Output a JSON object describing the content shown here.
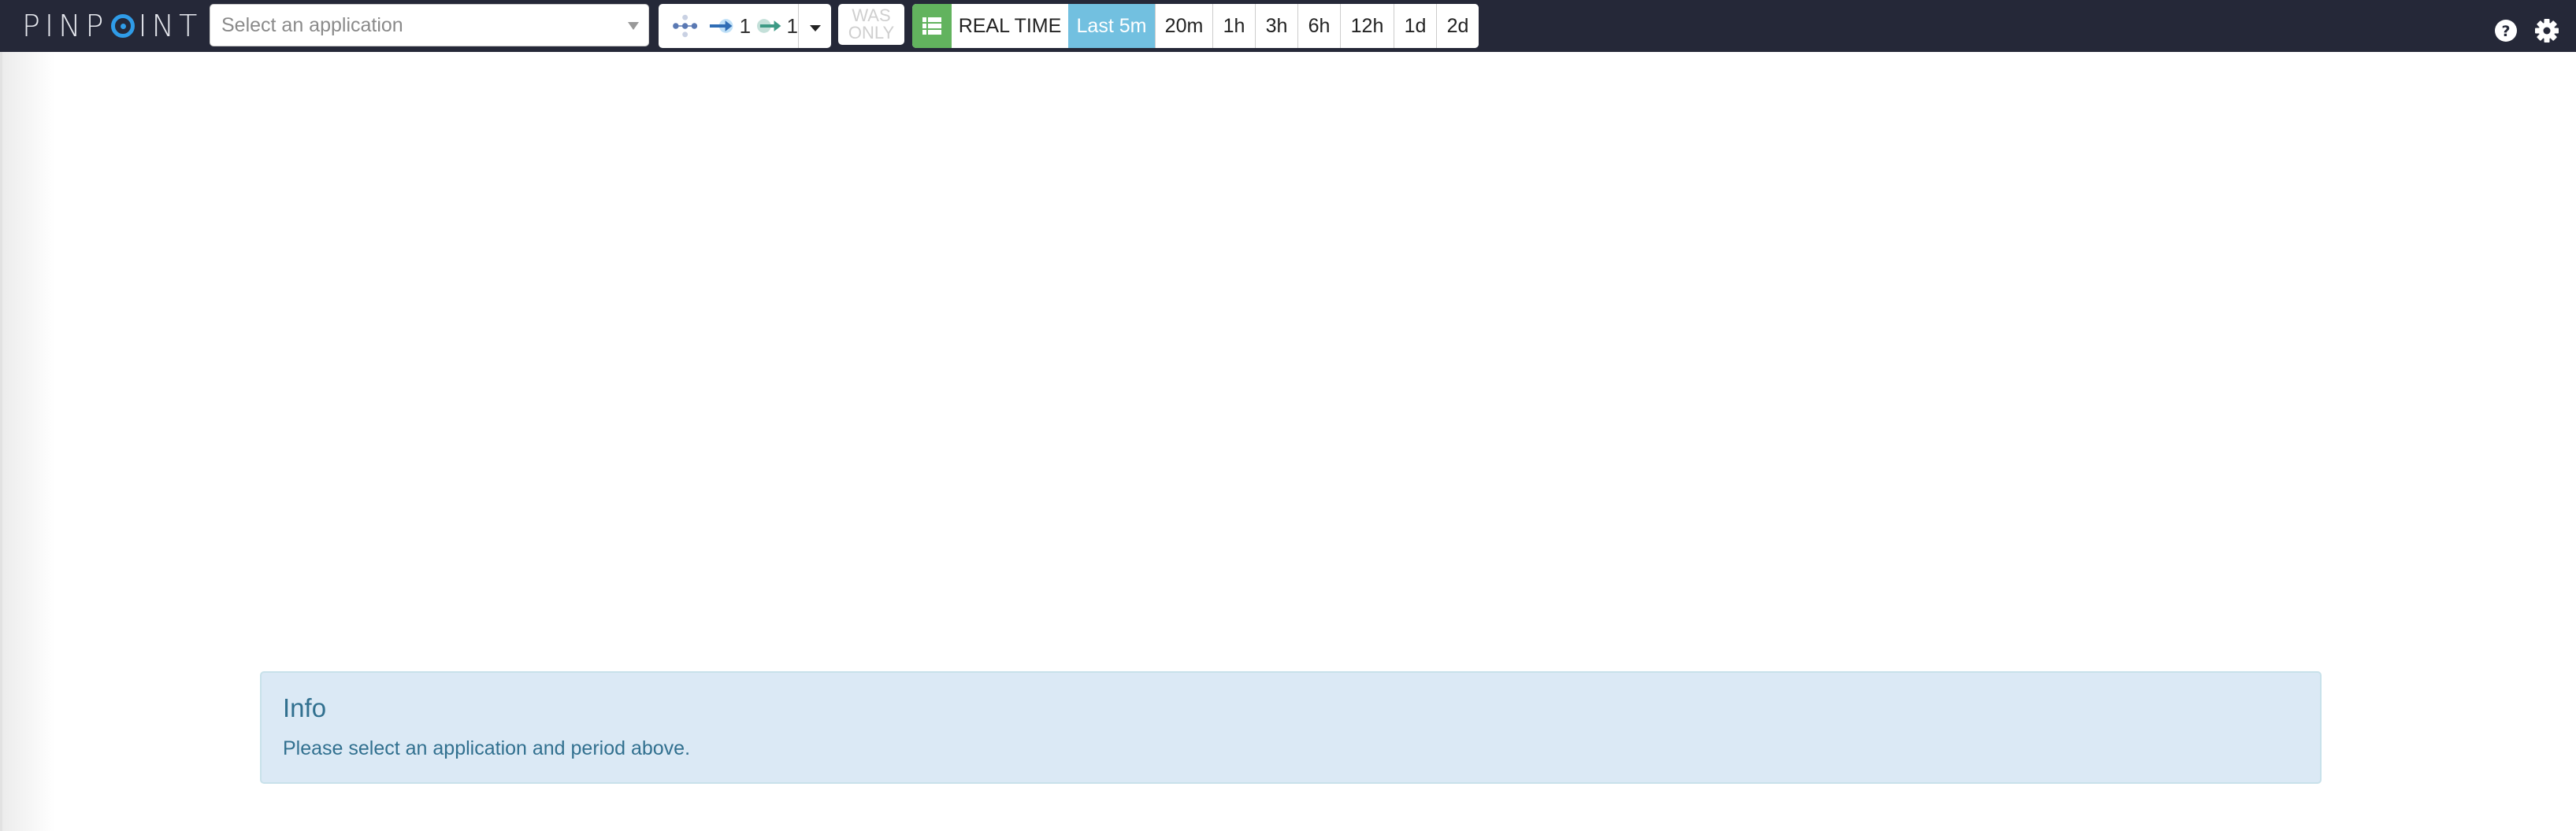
{
  "header": {
    "logo_text_before": "PINP",
    "logo_text_after": "INT",
    "app_select": {
      "placeholder": "Select an application"
    },
    "filter": {
      "node_icon": "server-map-nodes-icon",
      "inbound_icon": "inbound-arrow-icon",
      "inbound_count": "1",
      "outbound_icon": "outbound-arrow-icon",
      "outbound_count": "1"
    },
    "was_only": {
      "line1": "WAS",
      "line2": "ONLY"
    },
    "time_buttons": [
      {
        "label": "REAL TIME",
        "active": false
      },
      {
        "label": "Last 5m",
        "active": true
      },
      {
        "label": "20m",
        "active": false
      },
      {
        "label": "1h",
        "active": false
      },
      {
        "label": "3h",
        "active": false
      },
      {
        "label": "6h",
        "active": false
      },
      {
        "label": "12h",
        "active": false
      },
      {
        "label": "1d",
        "active": false
      },
      {
        "label": "2d",
        "active": false
      }
    ],
    "help_icon": "question-circle-icon",
    "settings_icon": "gear-icon"
  },
  "info": {
    "title": "Info",
    "message": "Please select an application and period above."
  },
  "colors": {
    "header_bg": "#252838",
    "logo_accent": "#2f9ce8",
    "active_time": "#72c0e0",
    "list_button": "#62b35e",
    "info_bg": "#dbe9f5",
    "info_text": "#31708f"
  }
}
